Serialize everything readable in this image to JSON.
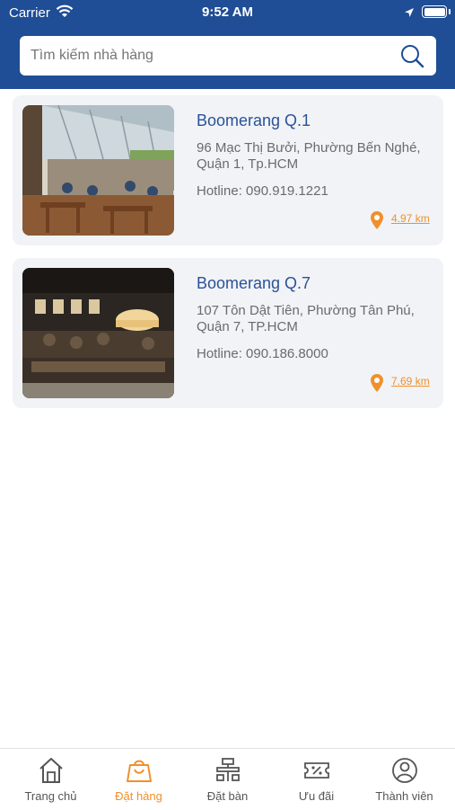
{
  "status_bar": {
    "carrier": "Carrier",
    "time": "9:52 AM"
  },
  "search": {
    "placeholder": "Tìm kiếm nhà hàng"
  },
  "restaurants": [
    {
      "name": "Boomerang Q.1",
      "address": "96 Mạc Thị Bưởi, Phường Bến Nghé, Quận 1, Tp.HCM",
      "hotline": "Hotline: 090.919.1221",
      "distance": "4.97 km"
    },
    {
      "name": "Boomerang Q.7",
      "address": "107 Tôn Dật Tiên, Phường Tân Phú, Quận 7, TP.HCM",
      "hotline": "Hotline: 090.186.8000",
      "distance": "7.69 km"
    }
  ],
  "tabbar": {
    "items": [
      {
        "label": "Trang chủ",
        "icon": "home-icon"
      },
      {
        "label": "Đặt hàng",
        "icon": "shopping-bag-icon",
        "active": true
      },
      {
        "label": "Đặt bàn",
        "icon": "table-icon"
      },
      {
        "label": "Ưu đãi",
        "icon": "coupon-icon"
      },
      {
        "label": "Thành viên",
        "icon": "user-icon"
      }
    ]
  },
  "colors": {
    "header": "#1f4d96",
    "accent": "#f0902c",
    "title": "#2a5298"
  }
}
